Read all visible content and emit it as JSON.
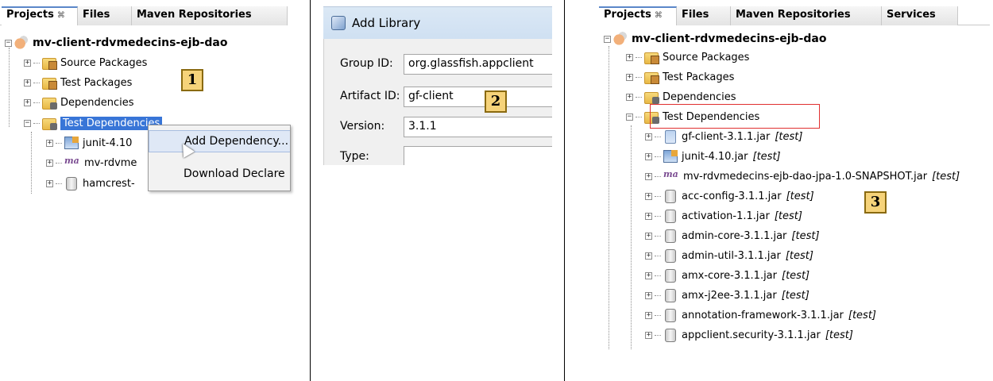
{
  "panel1": {
    "tabs": [
      {
        "label": "Projects",
        "close": "⌘"
      },
      {
        "label": "Files"
      },
      {
        "label": "Maven Repositories"
      }
    ],
    "project": "mv-client-rdvmedecins-ejb-dao",
    "nodes": [
      "Source Packages",
      "Test Packages",
      "Dependencies",
      "Test Dependencies"
    ],
    "children": [
      "junit-4.10",
      "mv-rdvme",
      "hamcrest-"
    ],
    "context_menu": [
      "Add Dependency...",
      "Download Declare"
    ],
    "badge": "1"
  },
  "dialog": {
    "title": "Add Library",
    "fields": [
      {
        "label": "Group ID:",
        "value": "org.glassfish.appclient"
      },
      {
        "label": "Artifact ID:",
        "value": "gf-client"
      },
      {
        "label": "Version:",
        "value": "3.1.1"
      },
      {
        "label": "Type:",
        "value": ""
      }
    ],
    "badge": "2"
  },
  "panel3": {
    "tabs": [
      {
        "label": "Projects",
        "close": "⌘"
      },
      {
        "label": "Files"
      },
      {
        "label": "Maven Repositories"
      },
      {
        "label": "Services"
      }
    ],
    "project": "mv-client-rdvmedecins-ejb-dao",
    "nodes": [
      "Source Packages",
      "Test Packages",
      "Dependencies",
      "Test Dependencies"
    ],
    "test_tag": "[test]",
    "children": [
      "gf-client-3.1.1.jar",
      "junit-4.10.jar",
      "mv-rdvmedecins-ejb-dao-jpa-1.0-SNAPSHOT.jar",
      "acc-config-3.1.1.jar",
      "activation-1.1.jar",
      "admin-core-3.1.1.jar",
      "admin-util-3.1.1.jar",
      "amx-core-3.1.1.jar",
      "amx-j2ee-3.1.1.jar",
      "annotation-framework-3.1.1.jar",
      "appclient.security-3.1.1.jar"
    ],
    "badge": "3"
  },
  "colors": {
    "selection": "#3875d7",
    "highlight_box": "#e03030",
    "badge": "#f6d37a"
  },
  "icons": [
    "project-icon",
    "folder-icon",
    "package-badge-icon",
    "jar-icon",
    "junit-jar-icon",
    "maven-project-icon",
    "mouse-cursor-icon",
    "library-icon"
  ]
}
